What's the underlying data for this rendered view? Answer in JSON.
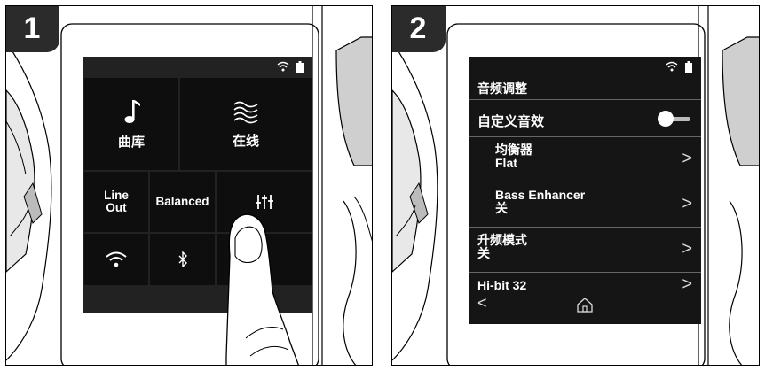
{
  "panels": [
    {
      "step": "1",
      "status_icons": [
        "wifi-icon",
        "battery-icon"
      ],
      "tiles": [
        {
          "icon": "music-note-icon",
          "label": "曲库"
        },
        {
          "icon": "waves-icon",
          "label": "在线"
        },
        {
          "icon": "",
          "label": "Line\nOut"
        },
        {
          "icon": "",
          "label": "Balanced"
        },
        {
          "icon": "sliders-icon",
          "label": ""
        },
        {
          "icon": "wifi-icon",
          "label": ""
        },
        {
          "icon": "bluetooth-icon",
          "label": ""
        }
      ]
    },
    {
      "step": "2",
      "status_icons": [
        "wifi-icon",
        "battery-icon"
      ],
      "title": "音频调整",
      "toggle_label": "自定义音效",
      "items": [
        {
          "label": "均衡器",
          "value": "Flat"
        },
        {
          "label": "Bass Enhancer",
          "value": "关"
        },
        {
          "label": "升频模式",
          "value": "关"
        },
        {
          "label": "Hi-bit 32",
          "value": ""
        }
      ],
      "nav": {
        "back": "<",
        "home": "home-icon"
      }
    }
  ],
  "colors": {
    "screen_bg": "#222222",
    "tile_bg": "#0e0e0e",
    "badge_bg": "#2b2b2b"
  }
}
